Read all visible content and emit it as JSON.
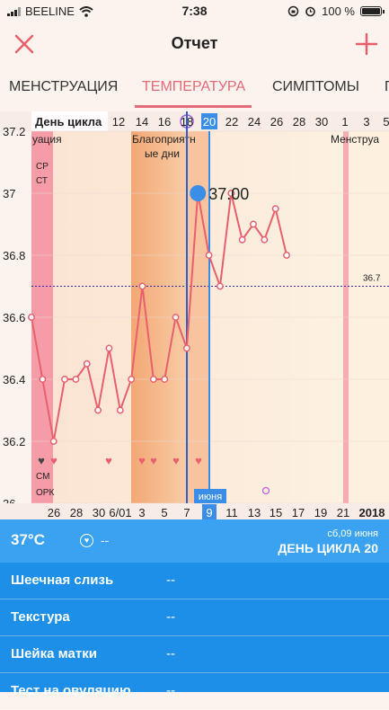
{
  "status_bar": {
    "carrier": "BEELINE",
    "time": "7:38",
    "battery": "100 %"
  },
  "nav": {
    "title": "Отчет"
  },
  "tabs": [
    {
      "label": "МЕНСТРУАЦИЯ"
    },
    {
      "label": "ТЕМПЕРАТУРА"
    },
    {
      "label": "СИМПТОМЫ"
    },
    {
      "label": "П"
    }
  ],
  "chart_data": {
    "type": "line",
    "header_label": "День цикла",
    "cycle_day_ticks": [
      "12",
      "14",
      "16",
      "18",
      "20",
      "22",
      "24",
      "26",
      "28",
      "30",
      "1",
      "3",
      "5"
    ],
    "selected_cycle_day": "20",
    "date_ticks": [
      "26",
      "28",
      "30",
      "6/01",
      "3",
      "5",
      "7",
      "9",
      "11",
      "13",
      "15",
      "17",
      "19",
      "21",
      "2018"
    ],
    "selected_date": "9",
    "month_label": "июня",
    "y_ticks": [
      "37.2",
      "37",
      "36.8",
      "36.6",
      "36.4",
      "36.2",
      "36"
    ],
    "ylim": [
      36,
      37.2
    ],
    "coverline": 36.7,
    "coverline_label": "36.7",
    "selected_value_label": "37.00",
    "period_label_left": "уация",
    "period_label_right": "Менструа",
    "fertile_label_line1": "Благоприятн",
    "fertile_label_line2": "ые дни",
    "left_tags": {
      "top1": "СР",
      "top2": "СТ",
      "bottom1": "СМ",
      "bottom2": "ОРК"
    },
    "series": [
      {
        "values": [
          36.6,
          36.4,
          36.2,
          36.4,
          36.4,
          36.45,
          36.3,
          36.5,
          36.3,
          36.4,
          36.7,
          36.4,
          36.4,
          36.6,
          36.5,
          37.0,
          36.8,
          36.7,
          37.0,
          36.85,
          36.9,
          36.85,
          36.95,
          36.8
        ]
      }
    ],
    "colors": {
      "line": "#e8606d",
      "period": "#f48fa0",
      "fertile": "#f4a878",
      "selected": "#3b8ee8",
      "coverline": "#2a2ab8"
    }
  },
  "details": {
    "temperature": "37°C",
    "note_value": "--",
    "date": "сб,09 июня",
    "cycle_day": "ДЕНЬ ЦИКЛА 20",
    "rows": [
      {
        "label": "Шеечная слизь",
        "value": "--"
      },
      {
        "label": "Текстура",
        "value": "--"
      },
      {
        "label": "Шейка матки",
        "value": "--"
      },
      {
        "label": "Тест на овуляцию",
        "value": "--"
      }
    ]
  }
}
